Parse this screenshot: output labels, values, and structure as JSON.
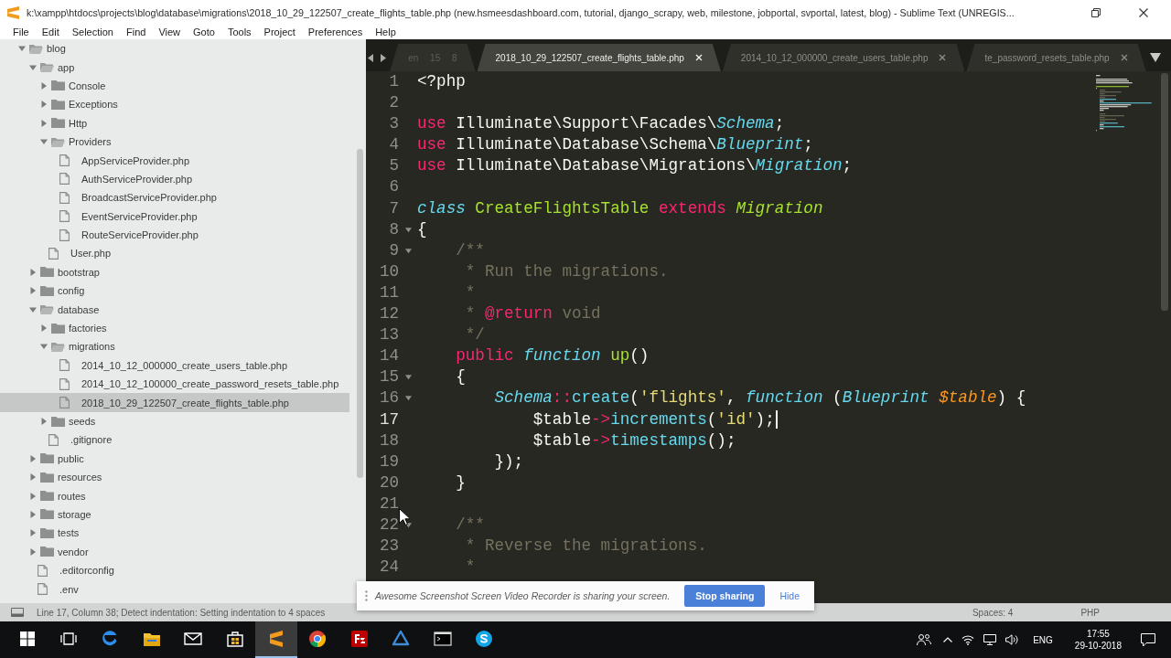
{
  "window": {
    "title": "k:\\xampp\\htdocs\\projects\\blog\\database\\migrations\\2018_10_29_122507_create_flights_table.php (new.hsmeesdashboard.com, tutorial, django_scrapy, web, milestone, jobportal, svportal, latest, blog) - Sublime Text (UNREGIS...",
    "menu": [
      "File",
      "Edit",
      "Selection",
      "Find",
      "View",
      "Goto",
      "Tools",
      "Project",
      "Preferences",
      "Help"
    ]
  },
  "sidebar": {
    "items": [
      {
        "kind": "folder",
        "label": "blog",
        "expanded": true,
        "selected": false,
        "children": [
          {
            "kind": "folder",
            "label": "app",
            "expanded": true,
            "selected": false,
            "children": [
              {
                "kind": "folder",
                "label": "Console",
                "expanded": false,
                "selected": false
              },
              {
                "kind": "folder",
                "label": "Exceptions",
                "expanded": false,
                "selected": false
              },
              {
                "kind": "folder",
                "label": "Http",
                "expanded": false,
                "selected": false
              },
              {
                "kind": "folder",
                "label": "Providers",
                "expanded": true,
                "selected": false,
                "children": [
                  {
                    "kind": "file",
                    "label": "AppServiceProvider.php",
                    "selected": false
                  },
                  {
                    "kind": "file",
                    "label": "AuthServiceProvider.php",
                    "selected": false
                  },
                  {
                    "kind": "file",
                    "label": "BroadcastServiceProvider.php",
                    "selected": false
                  },
                  {
                    "kind": "file",
                    "label": "EventServiceProvider.php",
                    "selected": false
                  },
                  {
                    "kind": "file",
                    "label": "RouteServiceProvider.php",
                    "selected": false
                  }
                ]
              },
              {
                "kind": "file",
                "label": "User.php",
                "selected": false
              }
            ]
          },
          {
            "kind": "folder",
            "label": "bootstrap",
            "expanded": false,
            "selected": false
          },
          {
            "kind": "folder",
            "label": "config",
            "expanded": false,
            "selected": false
          },
          {
            "kind": "folder",
            "label": "database",
            "expanded": true,
            "selected": false,
            "children": [
              {
                "kind": "folder",
                "label": "factories",
                "expanded": false,
                "selected": false
              },
              {
                "kind": "folder",
                "label": "migrations",
                "expanded": true,
                "selected": false,
                "children": [
                  {
                    "kind": "file",
                    "label": "2014_10_12_000000_create_users_table.php",
                    "selected": false
                  },
                  {
                    "kind": "file",
                    "label": "2014_10_12_100000_create_password_resets_table.php",
                    "selected": false
                  },
                  {
                    "kind": "file",
                    "label": "2018_10_29_122507_create_flights_table.php",
                    "selected": true
                  }
                ]
              },
              {
                "kind": "folder",
                "label": "seeds",
                "expanded": false,
                "selected": false
              },
              {
                "kind": "file",
                "label": ".gitignore",
                "selected": false
              }
            ]
          },
          {
            "kind": "folder",
            "label": "public",
            "expanded": false,
            "selected": false
          },
          {
            "kind": "folder",
            "label": "resources",
            "expanded": false,
            "selected": false
          },
          {
            "kind": "folder",
            "label": "routes",
            "expanded": false,
            "selected": false
          },
          {
            "kind": "folder",
            "label": "storage",
            "expanded": false,
            "selected": false
          },
          {
            "kind": "folder",
            "label": "tests",
            "expanded": false,
            "selected": false
          },
          {
            "kind": "folder",
            "label": "vendor",
            "expanded": false,
            "selected": false
          },
          {
            "kind": "file",
            "label": ".editorconfig",
            "selected": false
          },
          {
            "kind": "file",
            "label": ".env",
            "selected": false
          }
        ]
      }
    ]
  },
  "editor": {
    "tabs": [
      {
        "kind": "overflow",
        "label": "en 15 8",
        "selected": false
      },
      {
        "kind": "file",
        "label": "2018_10_29_122507_create_flights_table.php",
        "selected": true
      },
      {
        "kind": "file",
        "label": "2014_10_12_000000_create_users_table.php",
        "selected": false
      },
      {
        "kind": "file",
        "label": "te_password_resets_table.php",
        "selected": false
      }
    ],
    "lines": [
      {
        "number": "1",
        "fold": false,
        "current": false,
        "tokens": [
          {
            "kind": "plain",
            "text": "<?php"
          }
        ]
      },
      {
        "number": "2",
        "fold": false,
        "current": false
      },
      {
        "number": "3",
        "fold": false,
        "current": false,
        "tokens": [
          {
            "kind": "keyword",
            "text": "use"
          },
          {
            "kind": "plain",
            "text": " Illuminate\\Support\\Facades\\"
          },
          {
            "kind": "support",
            "text": "Schema"
          },
          {
            "kind": "plain",
            "text": ";"
          }
        ]
      },
      {
        "number": "4",
        "fold": false,
        "current": false,
        "tokens": [
          {
            "kind": "keyword",
            "text": "use"
          },
          {
            "kind": "plain",
            "text": " Illuminate\\Database\\Schema\\"
          },
          {
            "kind": "support",
            "text": "Blueprint"
          },
          {
            "kind": "plain",
            "text": ";"
          }
        ]
      },
      {
        "number": "5",
        "fold": false,
        "current": false,
        "tokens": [
          {
            "kind": "keyword",
            "text": "use"
          },
          {
            "kind": "plain",
            "text": " Illuminate\\Database\\Migrations\\"
          },
          {
            "kind": "support",
            "text": "Migration"
          },
          {
            "kind": "plain",
            "text": ";"
          }
        ]
      },
      {
        "number": "6",
        "fold": false,
        "current": false
      },
      {
        "number": "7",
        "fold": false,
        "current": false,
        "tokens": [
          {
            "kind": "storage",
            "text": "class"
          },
          {
            "kind": "entity",
            "text": " CreateFlightsTable"
          },
          {
            "kind": "keyword",
            "text": " extends"
          },
          {
            "kind": "inherited",
            "text": " Migration"
          }
        ]
      },
      {
        "number": "8",
        "fold": true,
        "current": false,
        "tokens": [
          {
            "kind": "plain",
            "text": "{"
          }
        ]
      },
      {
        "number": "9",
        "fold": true,
        "current": false,
        "tokens": [
          {
            "kind": "comment",
            "text": "    /**"
          }
        ]
      },
      {
        "number": "10",
        "fold": false,
        "current": false,
        "tokens": [
          {
            "kind": "comment",
            "text": "     * Run the migrations."
          }
        ]
      },
      {
        "number": "11",
        "fold": false,
        "current": false,
        "tokens": [
          {
            "kind": "comment",
            "text": "     *"
          }
        ]
      },
      {
        "number": "12",
        "fold": false,
        "current": false,
        "tokens": [
          {
            "kind": "comment",
            "text": "     * "
          },
          {
            "kind": "doctag",
            "text": "@return"
          },
          {
            "kind": "comment",
            "text": " void"
          }
        ]
      },
      {
        "number": "13",
        "fold": false,
        "current": false,
        "tokens": [
          {
            "kind": "comment",
            "text": "     */"
          }
        ]
      },
      {
        "number": "14",
        "fold": false,
        "current": false,
        "tokens": [
          {
            "kind": "keyword",
            "text": "    public"
          },
          {
            "kind": "storage",
            "text": " function"
          },
          {
            "kind": "entity",
            "text": " up"
          },
          {
            "kind": "plain",
            "text": "()"
          }
        ]
      },
      {
        "number": "15",
        "fold": true,
        "current": false,
        "tokens": [
          {
            "kind": "plain",
            "text": "    {"
          }
        ]
      },
      {
        "number": "16",
        "fold": true,
        "current": false,
        "tokens": [
          {
            "kind": "support",
            "text": "        Schema"
          },
          {
            "kind": "keyword",
            "text": "::"
          },
          {
            "kind": "call",
            "text": "create"
          },
          {
            "kind": "plain",
            "text": "("
          },
          {
            "kind": "string",
            "text": "'flights'"
          },
          {
            "kind": "plain",
            "text": ", "
          },
          {
            "kind": "storage",
            "text": "function"
          },
          {
            "kind": "plain",
            "text": " ("
          },
          {
            "kind": "support",
            "text": "Blueprint"
          },
          {
            "kind": "parameter",
            "text": " $table"
          },
          {
            "kind": "plain",
            "text": ") {"
          }
        ]
      },
      {
        "number": "17",
        "fold": false,
        "current": true,
        "tokens": [
          {
            "kind": "plain",
            "text": "            $table"
          },
          {
            "kind": "keyword",
            "text": "->"
          },
          {
            "kind": "call",
            "text": "increments"
          },
          {
            "kind": "plain",
            "text": "("
          },
          {
            "kind": "string",
            "text": "'id'"
          },
          {
            "kind": "plain",
            "text": ");"
          }
        ]
      },
      {
        "number": "18",
        "fold": false,
        "current": false,
        "tokens": [
          {
            "kind": "plain",
            "text": "            $table"
          },
          {
            "kind": "keyword",
            "text": "->"
          },
          {
            "kind": "call",
            "text": "timestamps"
          },
          {
            "kind": "plain",
            "text": "();"
          }
        ]
      },
      {
        "number": "19",
        "fold": false,
        "current": false,
        "tokens": [
          {
            "kind": "plain",
            "text": "        });"
          }
        ]
      },
      {
        "number": "20",
        "fold": false,
        "current": false,
        "tokens": [
          {
            "kind": "plain",
            "text": "    }"
          }
        ]
      },
      {
        "number": "21",
        "fold": false,
        "current": false
      },
      {
        "number": "22",
        "fold": true,
        "current": false,
        "tokens": [
          {
            "kind": "comment",
            "text": "    /**"
          }
        ]
      },
      {
        "number": "23",
        "fold": false,
        "current": false,
        "tokens": [
          {
            "kind": "comment",
            "text": "     * Reverse the migrations."
          }
        ]
      },
      {
        "number": "24",
        "fold": false,
        "current": false,
        "tokens": [
          {
            "kind": "comment",
            "text": "     *"
          }
        ]
      }
    ]
  },
  "status_bar": {
    "message": "Line 17, Column 38; Detect indentation: Setting indentation to 4 spaces",
    "indentation": "Spaces: 4",
    "syntax": "PHP"
  },
  "share_notice": {
    "message": "Awesome Screenshot Screen Video Recorder is sharing your screen.",
    "stop_button": "Stop sharing",
    "hide_link": "Hide"
  },
  "taskbar": {
    "buttons": [
      {
        "kind": "start",
        "selected": false
      },
      {
        "kind": "task-view",
        "selected": false
      },
      {
        "kind": "edge",
        "selected": false
      },
      {
        "kind": "explorer",
        "selected": false
      },
      {
        "kind": "mail",
        "selected": false
      },
      {
        "kind": "store",
        "selected": false
      },
      {
        "kind": "sublime",
        "selected": true
      },
      {
        "kind": "chrome",
        "selected": false
      },
      {
        "kind": "filezilla",
        "selected": false
      },
      {
        "kind": "triangle",
        "selected": false
      },
      {
        "kind": "terminal",
        "selected": false
      },
      {
        "kind": "skype",
        "selected": false
      }
    ],
    "tray": {
      "language": "ENG",
      "time": "17:55",
      "date": "29-10-2018"
    }
  }
}
